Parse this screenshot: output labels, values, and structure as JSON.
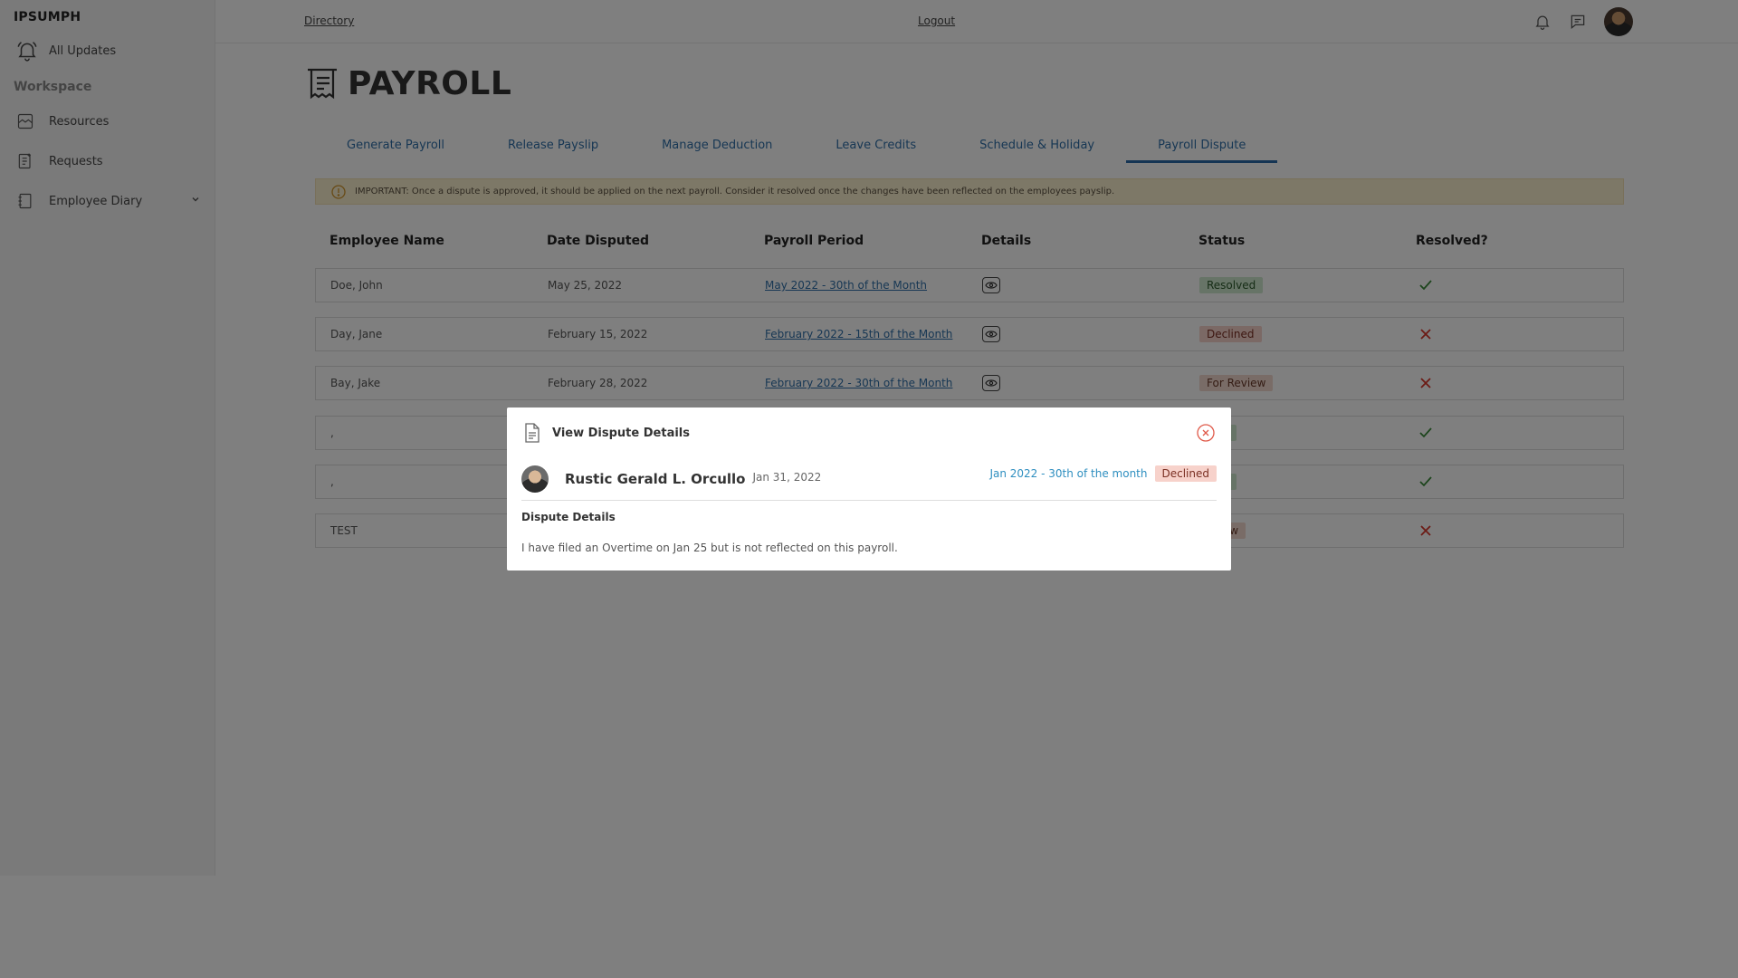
{
  "sidebar": {
    "brand": "IPSUMPH",
    "all_updates": "All Updates",
    "section": "Workspace",
    "items": [
      {
        "label": "Resources",
        "icon": "resources-icon"
      },
      {
        "label": "Requests",
        "icon": "requests-icon"
      },
      {
        "label": "Employee Diary",
        "icon": "diary-icon"
      }
    ]
  },
  "topbar": {
    "directory": "Directory",
    "logout": "Logout"
  },
  "page": {
    "title": "PAYROLL"
  },
  "tabs": [
    {
      "label": "Generate Payroll",
      "active": false
    },
    {
      "label": "Release Payslip",
      "active": false
    },
    {
      "label": "Manage Deduction",
      "active": false
    },
    {
      "label": "Leave Credits",
      "active": false
    },
    {
      "label": "Schedule & Holiday",
      "active": false
    },
    {
      "label": "Payroll Dispute",
      "active": true
    }
  ],
  "alert": {
    "text": "IMPORTANT: Once a dispute is approved, it should be applied on the next payroll. Consider it resolved once the changes have been reflected on the employees payslip."
  },
  "table": {
    "headers": [
      "Employee Name",
      "Date Disputed",
      "Payroll Period",
      "Details",
      "Status",
      "Resolved?"
    ],
    "rows": [
      {
        "name": "Doe, John",
        "date": "May 25, 2022",
        "period": "May 2022 - 30th of the Month",
        "status": "Resolved",
        "resolved": true
      },
      {
        "name": "Day, Jane",
        "date": "February 15, 2022",
        "period": "February 2022 - 15th of the Month",
        "status": "Declined",
        "resolved": false
      },
      {
        "name": "Bay, Jake",
        "date": "February 28, 2022",
        "period": "February 2022 - 30th of the Month",
        "status": "For Review",
        "resolved": false
      },
      {
        "name": ",",
        "date": "",
        "period": "",
        "status": "lved",
        "resolved": true
      },
      {
        "name": ",",
        "date": "",
        "period": "",
        "status": "lved",
        "resolved": true
      },
      {
        "name": "TEST",
        "date": "",
        "period": "",
        "status": "eview",
        "resolved": false
      }
    ]
  },
  "modal": {
    "title": "View Dispute Details",
    "employee_name": "Rustic Gerald L. Orcullo",
    "date": "Jan 31, 2022",
    "period": "Jan 2022 - 30th of the month",
    "status": "Declined",
    "details_heading": "Dispute Details",
    "details_text": "I have filed an Overtime on Jan 25 but is not reflected on this payroll."
  },
  "colors": {
    "accent": "#2f6fa8",
    "alert_bg": "#fbf0cf",
    "resolved_bg": "#cfe8cf",
    "declined_bg": "#f7d2cb",
    "check": "#3a8a3a",
    "cross": "#d9362b"
  }
}
